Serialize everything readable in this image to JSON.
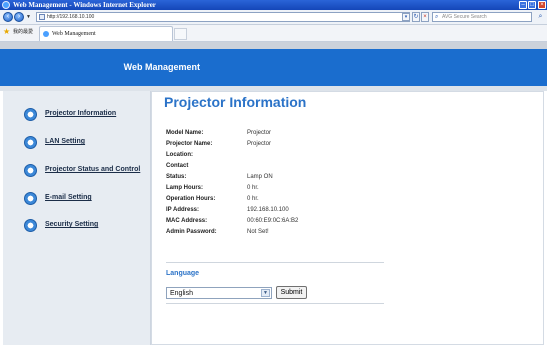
{
  "window": {
    "title": "Web Management - Windows Internet Explorer"
  },
  "browser": {
    "address": "http://192.168.10.100",
    "search_placeholder": "AVG Secure Search",
    "favorites_label": "我的最愛",
    "tab_label": "Web Management"
  },
  "page": {
    "banner_title": "Web Management",
    "sidebar": {
      "items": [
        {
          "label": "Projector Information"
        },
        {
          "label": "LAN Setting"
        },
        {
          "label": "Projector Status and Control"
        },
        {
          "label": "E-mail Setting"
        },
        {
          "label": "Security Setting"
        }
      ]
    },
    "main": {
      "title": "Projector Information",
      "info": [
        {
          "label": "Model Name:",
          "value": "Projector"
        },
        {
          "label": "Projector Name:",
          "value": "Projector"
        },
        {
          "label": "Location:",
          "value": ""
        },
        {
          "label": "Contact",
          "value": ""
        },
        {
          "label": "Status:",
          "value": "Lamp ON"
        },
        {
          "label": "Lamp Hours:",
          "value": "0 hr."
        },
        {
          "label": "Operation Hours:",
          "value": "0 hr."
        },
        {
          "label": "IP Address:",
          "value": "192.168.10.100"
        },
        {
          "label": "MAC Address:",
          "value": "00:60:E9:0C:6A:B2"
        },
        {
          "label": "Admin Password:",
          "value": "Not Set!"
        }
      ],
      "language_label": "Language",
      "language_selected": "English",
      "submit_label": "Submit"
    }
  }
}
